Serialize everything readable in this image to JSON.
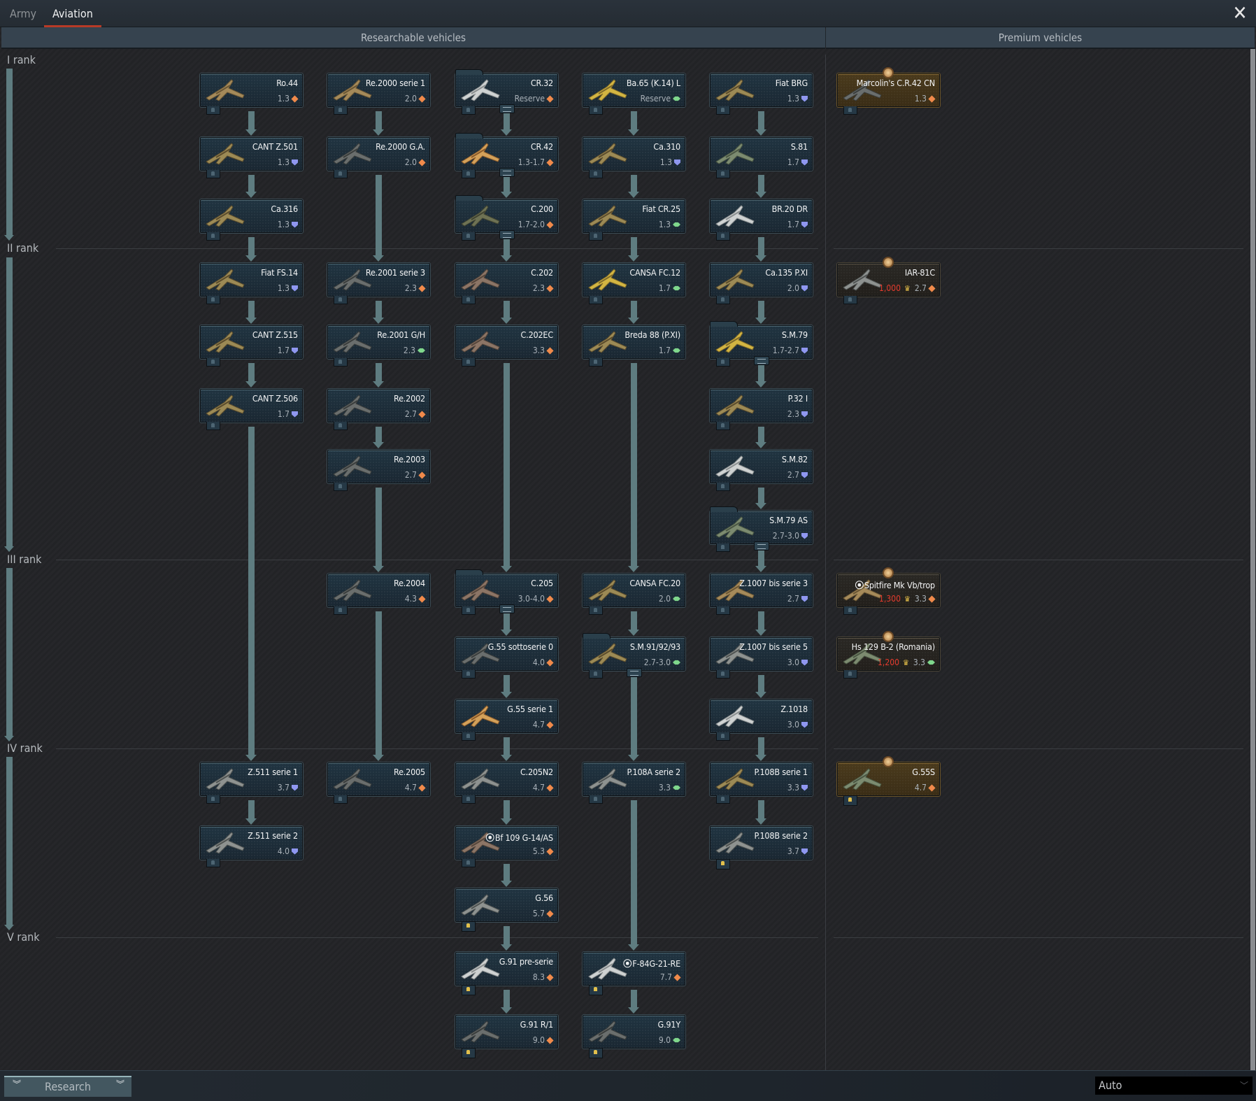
{
  "tabs": [
    {
      "label": "Army",
      "active": false
    },
    {
      "label": "Aviation",
      "active": true
    }
  ],
  "close_icon": "close-icon",
  "sections": {
    "researchable": "Researchable vehicles",
    "premium": "Premium vehicles"
  },
  "ranks": [
    "I rank",
    "II rank",
    "III rank",
    "IV rank",
    "V rank"
  ],
  "role_colors": {
    "fighter": "#f08a4b",
    "bomber": "#8f97f0",
    "attacker": "#7fd78c"
  },
  "vehicles": [
    {
      "id": "ro44",
      "name": "Ro.44",
      "br": "1.3",
      "role": "fighter",
      "col": 0,
      "row": 0,
      "livery": "sand"
    },
    {
      "id": "cantz501",
      "name": "CANT Z.501",
      "br": "1.3",
      "role": "bomber",
      "col": 0,
      "row": 1,
      "livery": "camo"
    },
    {
      "id": "ca316",
      "name": "Ca.316",
      "br": "1.3",
      "role": "bomber",
      "col": 0,
      "row": 2,
      "livery": "camo"
    },
    {
      "id": "fiatfs14",
      "name": "Fiat FS.14",
      "br": "1.3",
      "role": "bomber",
      "col": 0,
      "row": 3,
      "livery": "camo"
    },
    {
      "id": "cantz515",
      "name": "CANT Z.515",
      "br": "1.7",
      "role": "bomber",
      "col": 0,
      "row": 4,
      "livery": "camo"
    },
    {
      "id": "cantz506",
      "name": "CANT Z.506",
      "br": "1.7",
      "role": "bomber",
      "col": 0,
      "row": 5,
      "livery": "camo"
    },
    {
      "id": "z511s1",
      "name": "Z.511 serie 1",
      "br": "3.7",
      "role": "bomber",
      "col": 0,
      "row": 11,
      "livery": "grey"
    },
    {
      "id": "z511s2",
      "name": "Z.511 serie 2",
      "br": "4.0",
      "role": "bomber",
      "col": 0,
      "row": 12,
      "livery": "grey"
    },
    {
      "id": "re2000s1",
      "name": "Re.2000 serie 1",
      "br": "2.0",
      "role": "fighter",
      "col": 1,
      "row": 0,
      "livery": "sand"
    },
    {
      "id": "re2000ga",
      "name": "Re.2000 G.A.",
      "br": "2.0",
      "role": "fighter",
      "col": 1,
      "row": 1,
      "livery": "dark"
    },
    {
      "id": "re2001s3",
      "name": "Re.2001 serie 3",
      "br": "2.3",
      "role": "fighter",
      "col": 1,
      "row": 3,
      "livery": "dark"
    },
    {
      "id": "re2001gh",
      "name": "Re.2001 G/H",
      "br": "2.3",
      "role": "attacker",
      "col": 1,
      "row": 4,
      "livery": "dark"
    },
    {
      "id": "re2002",
      "name": "Re.2002",
      "br": "2.7",
      "role": "fighter",
      "col": 1,
      "row": 5,
      "livery": "dark"
    },
    {
      "id": "re2003",
      "name": "Re.2003",
      "br": "2.7",
      "role": "fighter",
      "col": 1,
      "row": 6,
      "livery": "dark"
    },
    {
      "id": "re2004",
      "name": "Re.2004",
      "br": "4.3",
      "role": "fighter",
      "col": 1,
      "row": 8,
      "livery": "dark"
    },
    {
      "id": "re2005",
      "name": "Re.2005",
      "br": "4.7",
      "role": "fighter",
      "col": 1,
      "row": 11,
      "livery": "dark"
    },
    {
      "id": "cr32",
      "name": "CR.32",
      "br": "Reserve",
      "role": "fighter",
      "col": 2,
      "row": 0,
      "livery": "white",
      "folder": true
    },
    {
      "id": "cr42",
      "name": "CR.42",
      "br": "1.3-1.7",
      "role": "fighter",
      "col": 2,
      "row": 1,
      "livery": "orange",
      "folder": true
    },
    {
      "id": "c200",
      "name": "C.200",
      "br": "1.7-2.0",
      "role": "fighter",
      "col": 2,
      "row": 2,
      "livery": "olive",
      "folder": true
    },
    {
      "id": "c202",
      "name": "C.202",
      "br": "2.3",
      "role": "fighter",
      "col": 2,
      "row": 3,
      "livery": "brown"
    },
    {
      "id": "c202ec",
      "name": "C.202EC",
      "br": "3.3",
      "role": "fighter",
      "col": 2,
      "row": 4,
      "livery": "brown"
    },
    {
      "id": "c205",
      "name": "C.205",
      "br": "3.0-4.0",
      "role": "fighter",
      "col": 2,
      "row": 8,
      "livery": "brown",
      "folder": true
    },
    {
      "id": "g55s0",
      "name": "G.55 sottoserie 0",
      "br": "4.0",
      "role": "fighter",
      "col": 2,
      "row": 9,
      "livery": "dark"
    },
    {
      "id": "g55s1",
      "name": "G.55 serie 1",
      "br": "4.7",
      "role": "fighter",
      "col": 2,
      "row": 10,
      "livery": "orange"
    },
    {
      "id": "c205n2",
      "name": "C.205N2",
      "br": "4.7",
      "role": "fighter",
      "col": 2,
      "row": 11,
      "livery": "grey"
    },
    {
      "id": "bf109g14as",
      "name": "Bf 109 G-14/AS",
      "br": "5.3",
      "role": "fighter",
      "col": 2,
      "row": 12,
      "livery": "brown",
      "squadron": true
    },
    {
      "id": "g56",
      "name": "G.56",
      "br": "5.7",
      "role": "fighter",
      "col": 2,
      "row": 13,
      "livery": "grey",
      "gold_crew": true
    },
    {
      "id": "g91pre",
      "name": "G.91 pre-serie",
      "br": "8.3",
      "role": "fighter",
      "col": 2,
      "row": 14,
      "livery": "white",
      "gold_crew": true
    },
    {
      "id": "g91r1",
      "name": "G.91 R/1",
      "br": "9.0",
      "role": "fighter",
      "col": 2,
      "row": 15,
      "livery": "dark",
      "gold_crew": true
    },
    {
      "id": "ba65",
      "name": "Ba.65 (K.14) L",
      "br": "Reserve",
      "role": "attacker",
      "col": 3,
      "row": 0,
      "livery": "yellow"
    },
    {
      "id": "ca310",
      "name": "Ca.310",
      "br": "1.3",
      "role": "bomber",
      "col": 3,
      "row": 1,
      "livery": "camo"
    },
    {
      "id": "fiatcr25",
      "name": "Fiat CR.25",
      "br": "1.3",
      "role": "attacker",
      "col": 3,
      "row": 2,
      "livery": "camo"
    },
    {
      "id": "cansafc12",
      "name": "CANSA FC.12",
      "br": "1.7",
      "role": "attacker",
      "col": 3,
      "row": 3,
      "livery": "yellow"
    },
    {
      "id": "breda88",
      "name": "Breda 88 (P.XI)",
      "br": "1.7",
      "role": "attacker",
      "col": 3,
      "row": 4,
      "livery": "camo"
    },
    {
      "id": "cansafc20",
      "name": "CANSA FC.20",
      "br": "2.0",
      "role": "attacker",
      "col": 3,
      "row": 8,
      "livery": "camo"
    },
    {
      "id": "sm919293",
      "name": "S.M.91/92/93",
      "br": "2.7-3.0",
      "role": "attacker",
      "col": 3,
      "row": 9,
      "livery": "camo",
      "folder": true
    },
    {
      "id": "p108as2",
      "name": "P.108A serie 2",
      "br": "3.3",
      "role": "attacker",
      "col": 3,
      "row": 11,
      "livery": "grey"
    },
    {
      "id": "f84g",
      "name": "F-84G-21-RE",
      "br": "7.7",
      "role": "fighter",
      "col": 3,
      "row": 14,
      "livery": "white",
      "squadron": true,
      "gold_crew": true
    },
    {
      "id": "g91y",
      "name": "G.91Y",
      "br": "9.0",
      "role": "attacker",
      "col": 3,
      "row": 15,
      "livery": "dark",
      "gold_crew": true
    },
    {
      "id": "fiatbrg",
      "name": "Fiat BRG",
      "br": "1.3",
      "role": "bomber",
      "col": 4,
      "row": 0,
      "livery": "camo"
    },
    {
      "id": "s81",
      "name": "S.81",
      "br": "1.7",
      "role": "bomber",
      "col": 4,
      "row": 1,
      "livery": "green"
    },
    {
      "id": "br20dr",
      "name": "BR.20 DR",
      "br": "1.7",
      "role": "bomber",
      "col": 4,
      "row": 2,
      "livery": "white"
    },
    {
      "id": "ca135",
      "name": "Ca.135 P.XI",
      "br": "2.0",
      "role": "bomber",
      "col": 4,
      "row": 3,
      "livery": "camo"
    },
    {
      "id": "sm79",
      "name": "S.M.79",
      "br": "1.7-2.7",
      "role": "bomber",
      "col": 4,
      "row": 4,
      "livery": "yellow",
      "folder": true
    },
    {
      "id": "p32i",
      "name": "P.32 I",
      "br": "2.3",
      "role": "bomber",
      "col": 4,
      "row": 5,
      "livery": "camo"
    },
    {
      "id": "sm82",
      "name": "S.M.82",
      "br": "2.7",
      "role": "bomber",
      "col": 4,
      "row": 6,
      "livery": "white"
    },
    {
      "id": "sm79as",
      "name": "S.M.79 AS",
      "br": "2.7-3.0",
      "role": "bomber",
      "col": 4,
      "row": 7,
      "livery": "green",
      "folder": true
    },
    {
      "id": "z1007s3",
      "name": "Z.1007 bis serie 3",
      "br": "2.7",
      "role": "bomber",
      "col": 4,
      "row": 8,
      "livery": "sand"
    },
    {
      "id": "z1007s5",
      "name": "Z.1007 bis serie 5",
      "br": "3.0",
      "role": "bomber",
      "col": 4,
      "row": 9,
      "livery": "grey"
    },
    {
      "id": "z1018",
      "name": "Z.1018",
      "br": "3.0",
      "role": "bomber",
      "col": 4,
      "row": 10,
      "livery": "white"
    },
    {
      "id": "p108bs1",
      "name": "P.108B serie 1",
      "br": "3.3",
      "role": "bomber",
      "col": 4,
      "row": 11,
      "livery": "camo"
    },
    {
      "id": "p108bs2",
      "name": "P.108B serie 2",
      "br": "3.7",
      "role": "bomber",
      "col": 4,
      "row": 12,
      "livery": "grey",
      "gold_crew": true
    }
  ],
  "premium_vehicles": [
    {
      "id": "marcolin",
      "name": "Marcolin's C.R.42 CN",
      "br": "1.3",
      "role": "fighter",
      "row": 0,
      "owned": true,
      "livery": "dark"
    },
    {
      "id": "iar81c",
      "name": "IAR-81C",
      "br": "2.7",
      "role": "fighter",
      "row": 3,
      "price": "1,000",
      "livery": "grey"
    },
    {
      "id": "spitfirevb",
      "name": "Spitfire Mk Vb/trop",
      "br": "3.3",
      "role": "fighter",
      "row": 8,
      "price": "1,300",
      "squadron": true,
      "livery": "sand"
    },
    {
      "id": "hs129b2",
      "name": "Hs 129 B-2 (Romania)",
      "br": "3.3",
      "role": "attacker",
      "row": 9,
      "price": "1,200",
      "livery": "green"
    },
    {
      "id": "g55s",
      "name": "G.55S",
      "br": "4.7",
      "role": "fighter",
      "row": 11,
      "owned": true,
      "gold_crew": true,
      "livery": "green"
    }
  ],
  "links": [
    {
      "col": 0,
      "from": 0,
      "to": 1
    },
    {
      "col": 0,
      "from": 1,
      "to": 2
    },
    {
      "col": 0,
      "from": 2,
      "to": 3
    },
    {
      "col": 0,
      "from": 3,
      "to": 4
    },
    {
      "col": 0,
      "from": 4,
      "to": 5
    },
    {
      "col": 0,
      "from": 5,
      "to": 11
    },
    {
      "col": 0,
      "from": 11,
      "to": 12
    },
    {
      "col": 1,
      "from": 0,
      "to": 1
    },
    {
      "col": 1,
      "from": 1,
      "to": 3
    },
    {
      "col": 1,
      "from": 3,
      "to": 4
    },
    {
      "col": 1,
      "from": 4,
      "to": 5
    },
    {
      "col": 1,
      "from": 5,
      "to": 6
    },
    {
      "col": 1,
      "from": 6,
      "to": 8
    },
    {
      "col": 1,
      "from": 8,
      "to": 11
    },
    {
      "col": 2,
      "from": 0,
      "to": 1
    },
    {
      "col": 2,
      "from": 1,
      "to": 2
    },
    {
      "col": 2,
      "from": 2,
      "to": 3
    },
    {
      "col": 2,
      "from": 3,
      "to": 4
    },
    {
      "col": 2,
      "from": 4,
      "to": 8
    },
    {
      "col": 2,
      "from": 8,
      "to": 9
    },
    {
      "col": 2,
      "from": 9,
      "to": 10
    },
    {
      "col": 2,
      "from": 10,
      "to": 11
    },
    {
      "col": 2,
      "from": 11,
      "to": 12
    },
    {
      "col": 2,
      "from": 12,
      "to": 13
    },
    {
      "col": 2,
      "from": 13,
      "to": 14
    },
    {
      "col": 2,
      "from": 14,
      "to": 15
    },
    {
      "col": 3,
      "from": 0,
      "to": 1
    },
    {
      "col": 3,
      "from": 1,
      "to": 2
    },
    {
      "col": 3,
      "from": 2,
      "to": 3
    },
    {
      "col": 3,
      "from": 3,
      "to": 4
    },
    {
      "col": 3,
      "from": 4,
      "to": 8
    },
    {
      "col": 3,
      "from": 8,
      "to": 9
    },
    {
      "col": 3,
      "from": 9,
      "to": 11
    },
    {
      "col": 3,
      "from": 11,
      "to": 14
    },
    {
      "col": 3,
      "from": 14,
      "to": 15
    },
    {
      "col": 4,
      "from": 0,
      "to": 1
    },
    {
      "col": 4,
      "from": 1,
      "to": 2
    },
    {
      "col": 4,
      "from": 2,
      "to": 3
    },
    {
      "col": 4,
      "from": 3,
      "to": 4
    },
    {
      "col": 4,
      "from": 4,
      "to": 5
    },
    {
      "col": 4,
      "from": 5,
      "to": 6
    },
    {
      "col": 4,
      "from": 6,
      "to": 7
    },
    {
      "col": 4,
      "from": 7,
      "to": 8
    },
    {
      "col": 4,
      "from": 8,
      "to": 9
    },
    {
      "col": 4,
      "from": 9,
      "to": 10
    },
    {
      "col": 4,
      "from": 10,
      "to": 11
    },
    {
      "col": 4,
      "from": 11,
      "to": 12
    }
  ],
  "bottom": {
    "research_label": "Research",
    "mode_select": "Auto"
  }
}
